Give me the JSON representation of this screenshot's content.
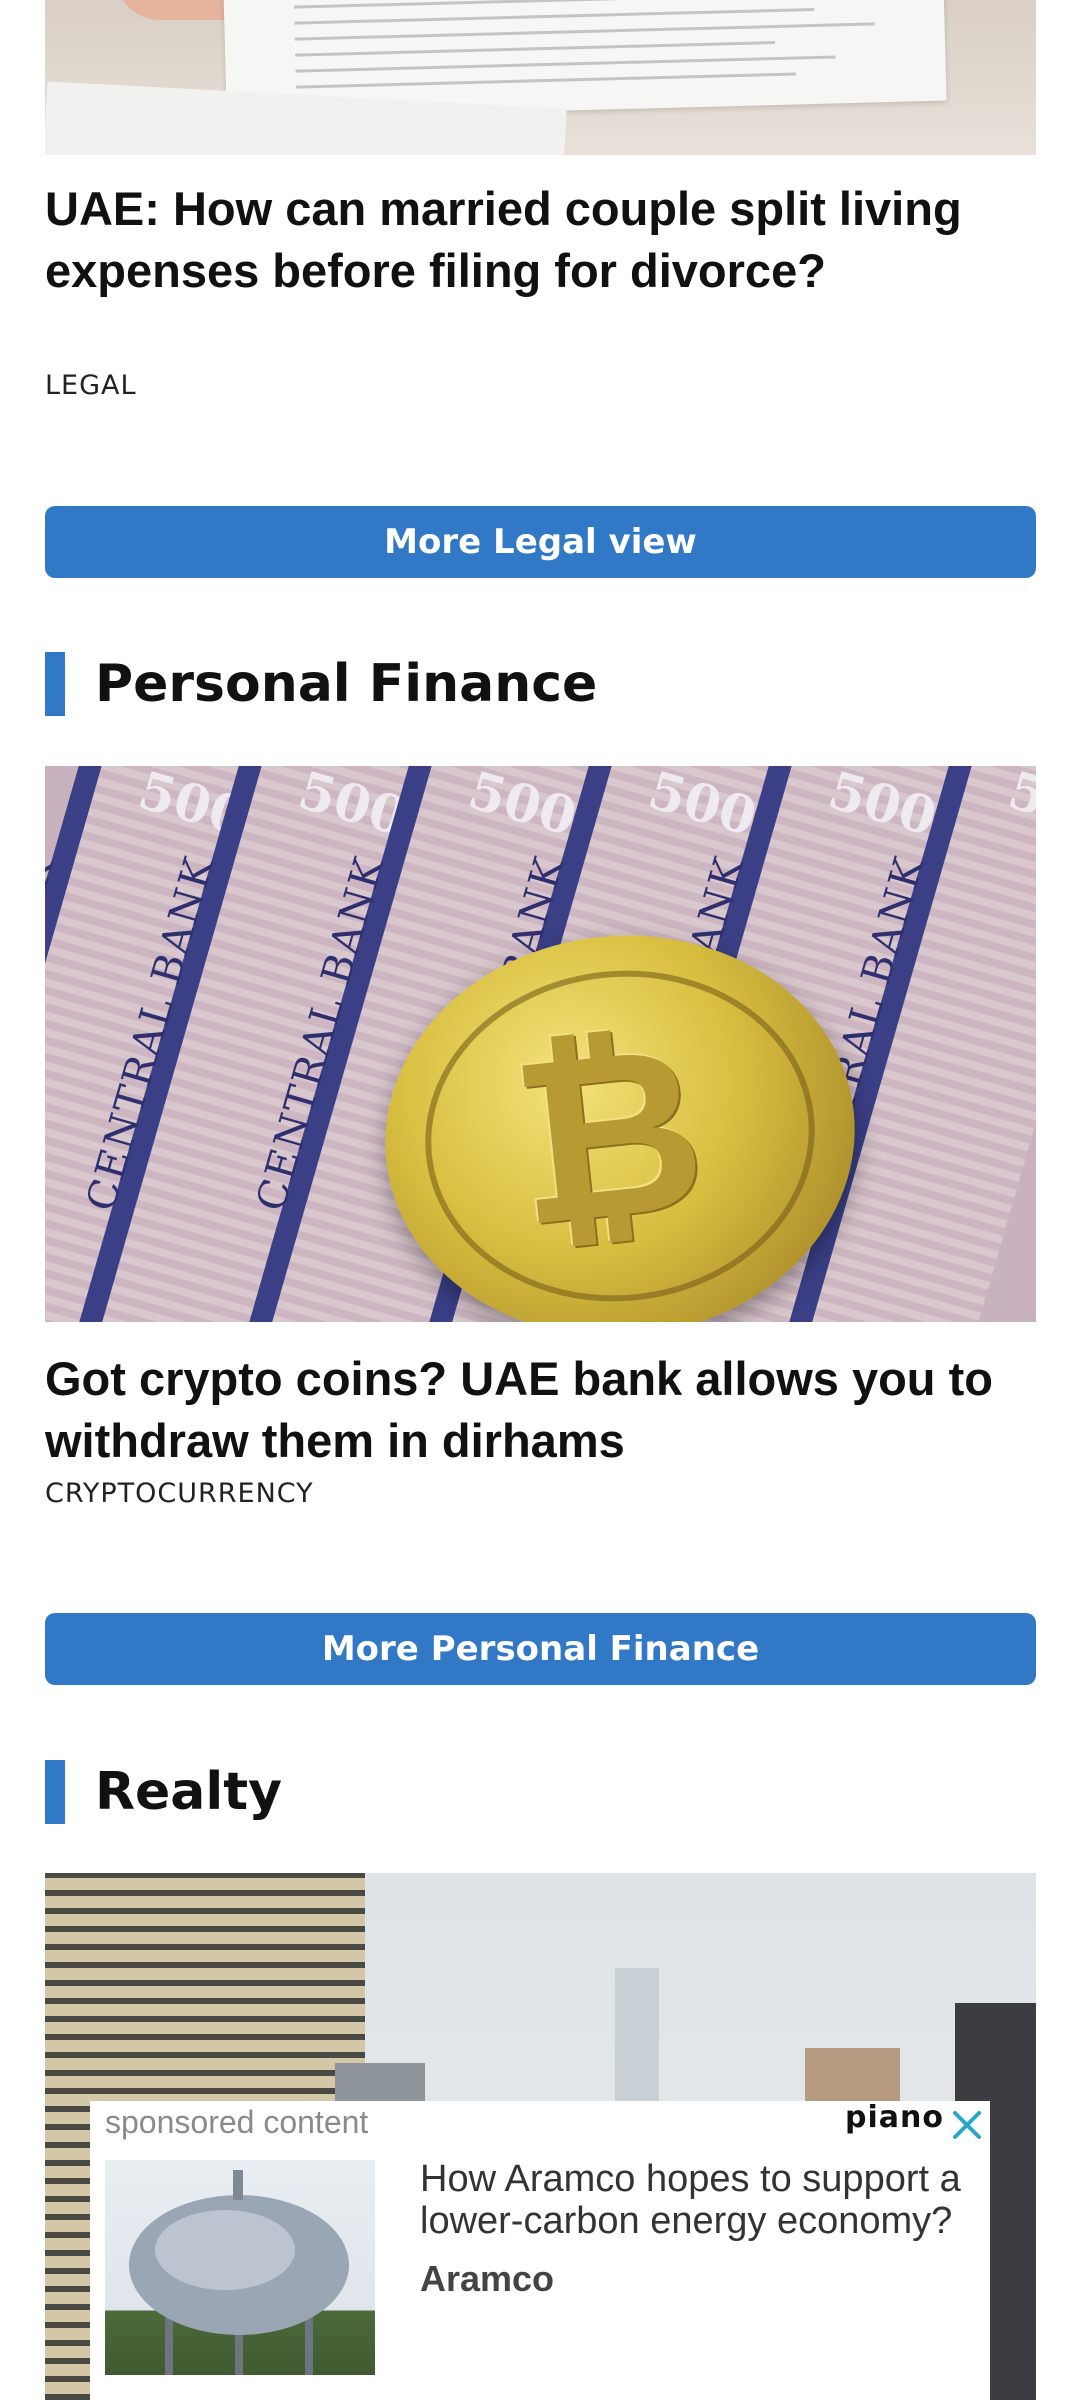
{
  "legal_article": {
    "headline": "UAE: How can married couple split living expenses before filing for divorce?",
    "category": "LEGAL"
  },
  "legal_more_button": "More Legal view",
  "personal_finance": {
    "section_title": "Personal Finance",
    "headline": "Got crypto coins? UAE bank allows you to withdraw them in dirhams",
    "category": "CRYPTOCURRENCY",
    "more_button": "More Personal Finance",
    "image": {
      "note_text": "CENTRAL BANK",
      "note_value": "500"
    }
  },
  "realty": {
    "section_title": "Realty"
  },
  "sponsored_ad": {
    "label": "sponsored content",
    "provider_logo": "piano",
    "title": "How Aramco hopes to support a lower-carbon energy economy?",
    "brand": "Aramco"
  },
  "colors": {
    "accent": "#3178c6",
    "text": "#111111",
    "ad_label": "#8a8a8a"
  },
  "icons": [
    "close-icon",
    "bitcoin-icon"
  ]
}
